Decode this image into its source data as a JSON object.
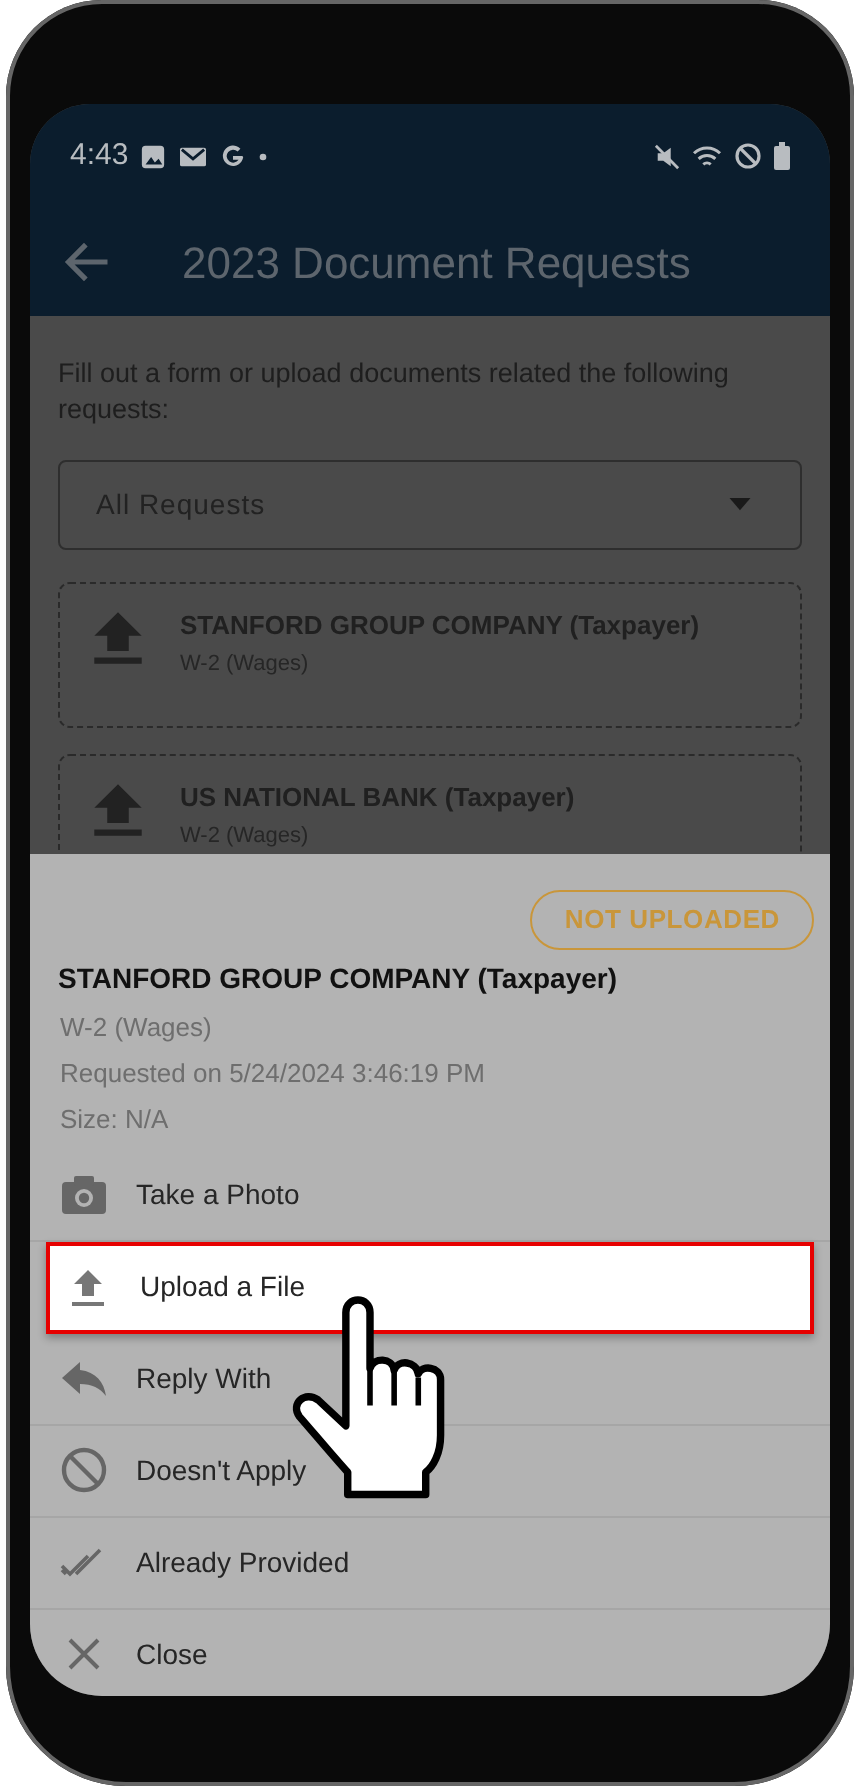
{
  "status_bar": {
    "time": "4:43"
  },
  "header": {
    "title": "2023 Document Requests"
  },
  "intro": "Fill out a form or upload documents related the following requests:",
  "filter": {
    "value": "All Requests"
  },
  "requests": [
    {
      "title": "STANFORD GROUP COMPANY (Taxpayer)",
      "subtitle": "W-2 (Wages)"
    },
    {
      "title": "US NATIONAL BANK (Taxpayer)",
      "subtitle": "W-2 (Wages)"
    }
  ],
  "sheet": {
    "status": "NOT UPLOADED",
    "title": "STANFORD GROUP COMPANY (Taxpayer)",
    "details": [
      "W-2 (Wages)",
      "Requested on 5/24/2024 3:46:19 PM",
      "Size: N/A"
    ],
    "actions": [
      {
        "kind": "camera",
        "label": "Take a Photo",
        "selected": false
      },
      {
        "kind": "upload",
        "label": "Upload a File",
        "selected": true
      },
      {
        "kind": "reply",
        "label": "Reply With",
        "selected": false
      },
      {
        "kind": "ban",
        "label": "Doesn't Apply",
        "selected": false
      },
      {
        "kind": "done",
        "label": "Already Provided",
        "selected": false
      },
      {
        "kind": "close",
        "label": "Close",
        "selected": false
      }
    ]
  }
}
